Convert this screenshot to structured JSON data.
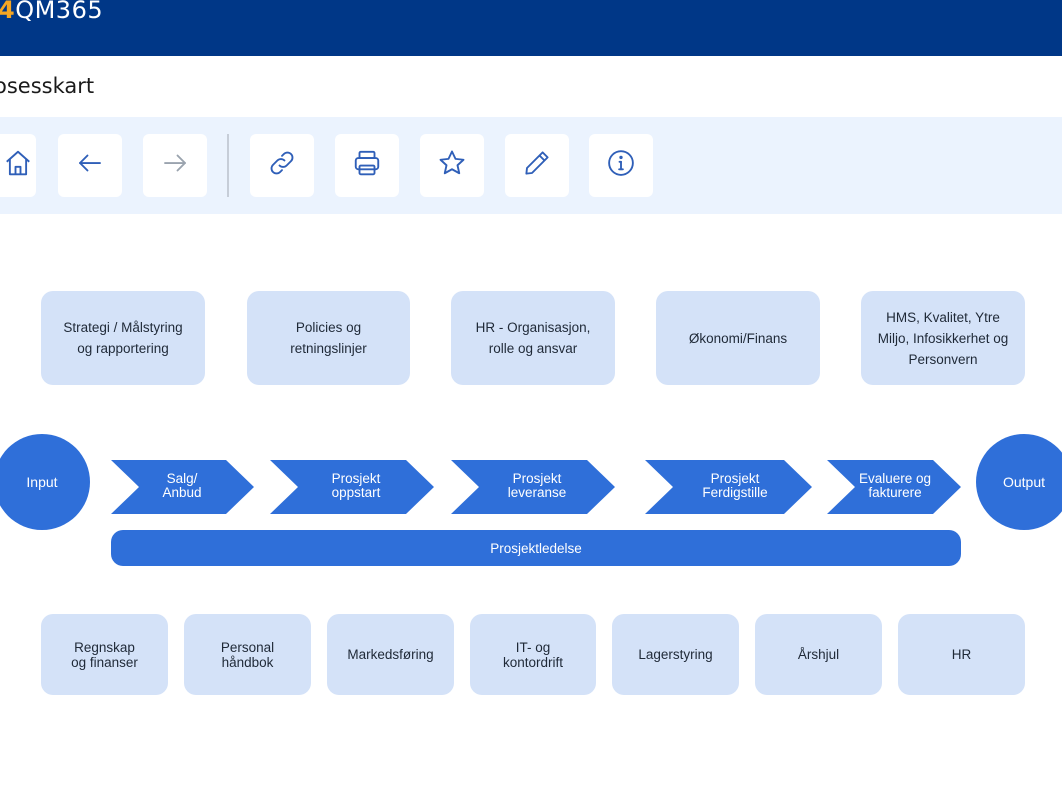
{
  "header": {
    "logo_mark": "4",
    "logo_text": "QM365",
    "brand_color": "#003787",
    "logo_accent": "#f5a623"
  },
  "page": {
    "title": "osesskart"
  },
  "toolbar": {
    "buttons": [
      {
        "name": "home",
        "icon": "home-icon"
      },
      {
        "name": "back",
        "icon": "arrow-left-icon"
      },
      {
        "name": "forward",
        "icon": "arrow-right-icon"
      },
      {
        "name": "link",
        "icon": "link-icon"
      },
      {
        "name": "print",
        "icon": "printer-icon"
      },
      {
        "name": "favorite",
        "icon": "star-icon"
      },
      {
        "name": "edit",
        "icon": "pencil-icon"
      },
      {
        "name": "info",
        "icon": "info-icon"
      }
    ]
  },
  "management_processes": [
    "Strategi / Målstyring\nog rapportering",
    "Policies og\nretningslinjer",
    "HR - Organisasjon,\nrolle og ansvar",
    "Økonomi/Finans",
    "HMS, Kvalitet, Ytre\nMiljo, Infosikkerhet og\nPersonvern"
  ],
  "core_process": {
    "input": "Input",
    "output": "Output",
    "steps": [
      "Salg/\nAnbud",
      "Prosjekt\noppstart",
      "Prosjekt\nleveranse",
      "Prosjekt\nFerdigstille",
      "Evaluere og\nfakturere"
    ],
    "management_bar": "Prosjektledelse",
    "color": "#2f6fd9"
  },
  "support_processes": [
    "Regnskap\nog finanser",
    "Personal\nhåndbok",
    "Markedsføring",
    "IT- og\nkontordrift",
    "Lagerstyring",
    "Årshjul",
    "HR"
  ],
  "colors": {
    "toolbar_bg": "#ebf3fe",
    "box_bg": "#d4e2f8"
  }
}
